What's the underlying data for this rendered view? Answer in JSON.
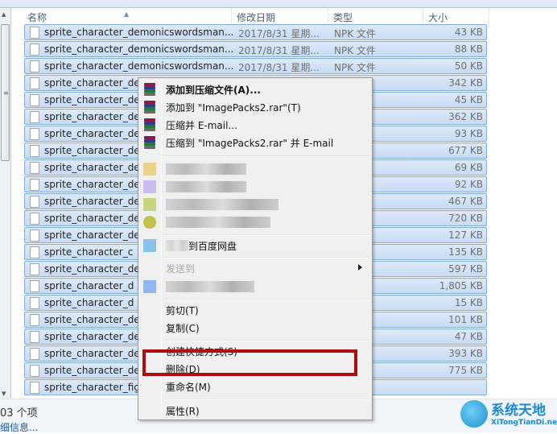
{
  "columns": {
    "name": "名称",
    "date": "修改日期",
    "type": "类型",
    "size": "大小"
  },
  "files": [
    {
      "name": "sprite_character_demonicswordsman...",
      "date": "2017/8/31 星期...",
      "type": "NPK 文件",
      "size": "43 KB"
    },
    {
      "name": "sprite_character_demonicswordsman...",
      "date": "2017/8/31 星期...",
      "type": "NPK 文件",
      "size": "88 KB"
    },
    {
      "name": "sprite_character_demonicswordsman...",
      "date": "2017/8/31 星期...",
      "type": "NPK 文件",
      "size": "50 KB"
    },
    {
      "name": "sprite_character_der",
      "size": "342 KB"
    },
    {
      "name": "sprite_character_der",
      "size": "45 KB"
    },
    {
      "name": "sprite_character_der",
      "size": "362 KB"
    },
    {
      "name": "sprite_character_der",
      "size": "93 KB"
    },
    {
      "name": "sprite_character_der",
      "size": "677 KB"
    },
    {
      "name": "sprite_character_der",
      "size": "69 KB"
    },
    {
      "name": "sprite_character_der",
      "size": "92 KB"
    },
    {
      "name": "sprite_character_der",
      "size": "467 KB"
    },
    {
      "name": "sprite_character_der",
      "size": "720 KB"
    },
    {
      "name": "sprite_character_de",
      "size": "127 KB"
    },
    {
      "name": "sprite_character_c",
      "size": "135 KB"
    },
    {
      "name": "sprite_character_der",
      "size": "597 KB"
    },
    {
      "name": "sprite_character_d",
      "size": "1,805 KB"
    },
    {
      "name": "sprite_character_d",
      "size": "15 KB"
    },
    {
      "name": "sprite_character_der",
      "size": "101 KB"
    },
    {
      "name": "sprite_character_der",
      "size": "47 KB"
    },
    {
      "name": "sprite_character_der",
      "size": "393 KB"
    },
    {
      "name": "sprite_character_der",
      "size": "775 KB"
    },
    {
      "name": "sprite_character_figh",
      "size": ""
    }
  ],
  "status": {
    "count": "03 个项",
    "details": "细信息..."
  },
  "context_menu": {
    "items": [
      {
        "label": "添加到压缩文件(A)...",
        "icon": "winrar-icon",
        "bold": true
      },
      {
        "label": "添加到 \"ImagePacks2.rar\"(T)",
        "icon": "winrar-icon"
      },
      {
        "label": "压缩并 E-mail...",
        "icon": "winrar-icon"
      },
      {
        "label": "压缩到 \"ImagePacks2.rar\" 并 E-mail",
        "icon": "winrar-icon"
      },
      {
        "label": "到百度网盘",
        "icon": "baidu-netdisk-icon"
      },
      {
        "label": "发送到",
        "submenu": true
      },
      {
        "label": "剪切(T)"
      },
      {
        "label": "复制(C)"
      },
      {
        "label": "创建快捷方式(S)"
      },
      {
        "label": "删除(D)"
      },
      {
        "label": "重命名(M)"
      },
      {
        "label": "属性(R)"
      }
    ]
  },
  "watermark": {
    "title": "系统天地",
    "url": "XiTongTianDi.net"
  },
  "colors": {
    "highlight": "#b00c0c",
    "selection": "#c8dcf5",
    "link": "#1d5aa8"
  }
}
